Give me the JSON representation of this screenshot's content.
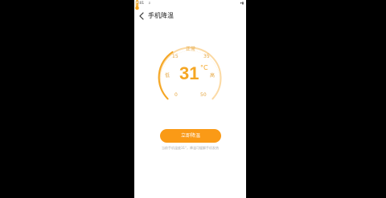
{
  "status_bar": {
    "time": "2:01",
    "notification_icon": "download-notification-icon",
    "signal_icons": "▾▮"
  },
  "header": {
    "back_icon": "back-chevron-icon",
    "title": "手机降温"
  },
  "gauge": {
    "label_normal": "正常",
    "label_15": "15",
    "label_35": "35",
    "label_low": "低",
    "label_high": "高",
    "label_0": "0",
    "label_50": "50",
    "thermometer_icon": "thermometer-icon",
    "temperature": "31",
    "unit": "°C",
    "range_min": 0,
    "range_max": 50,
    "current_value": 31
  },
  "action": {
    "button_label": "立即降温"
  },
  "hint": {
    "text": "当前手机温度31°，降温可缓解手机发热"
  },
  "colors": {
    "accent": "#f5a623",
    "button": "#fa9a16",
    "arc_light": "#fbd9a3"
  }
}
